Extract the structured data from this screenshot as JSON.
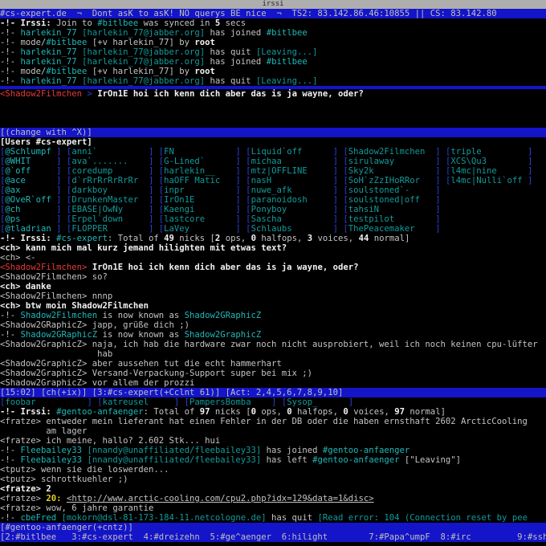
{
  "window": {
    "title": "irssi"
  },
  "c1": {
    "topic": "#cs-expert.de  ¬  Dont asK to asK! NO querys BE nice  ¬  TS2: 83.142.86.46:10855 || CS: 83.142.80",
    "l1a": "-!- Irssi: ",
    "l1b": "Join to ",
    "l1c": "#bitlbee",
    "l1d": " was synced in ",
    "l1e": "5",
    "l1f": " secs",
    "l2a": "-!- ",
    "l2b": "harlekin_77",
    "l2c": " [harlekin_77@jabber.org] ",
    "l2d": "has joined ",
    "l2e": "#bitlbee",
    "l3a": "-!- mode/",
    "l3b": "#bitlbee",
    "l3c": " [+v harlekin_77] by ",
    "l3d": "root",
    "l4a": "-!- ",
    "l4b": "harlekin_77",
    "l4c": " [harlekin_77@jabber.org] ",
    "l4d": "has quit ",
    "l4e": "[Leaving...]",
    "l5a": "-!- ",
    "l5b": "harlekin_77",
    "l5c": " [harlekin_77@jabber.org] ",
    "l5d": "has joined ",
    "l5e": "#bitlbee",
    "l6a": "-!- mode/",
    "l6b": "#bitlbee",
    "l6c": " [+v harlekin_77] by ",
    "l6d": "root",
    "l7a": "-!- ",
    "l7b": "harlekin_77",
    "l7c": " [harlekin_77@jabber.org] ",
    "l7d": "has quit ",
    "l7e": "[Leaving...]"
  },
  "c2": {
    "nick": "<Shadow2Filmchen",
    "sep": " > ",
    "msg": "IrOn1E hoi ich kenn dich aber das is ja wayne, oder?"
  },
  "c3": {
    "header": "[(change with ^X)]",
    "names": "[Users #cs-expert]",
    "rows": [
      [
        "@Schlumpf",
        "anni`",
        "FN",
        "Liquid`off",
        "Shadow2Filmchen",
        "triple"
      ],
      [
        "@WHIT",
        "ava`.......",
        "G-Lined`",
        "michaa",
        "sirulaway",
        "XCS\\Qu3"
      ],
      [
        "@`off",
        "coredump",
        "harlekin__",
        "mtz|OFFLINE",
        "Sky2k",
        "l4mc|nine"
      ],
      [
        "@ace",
        "d`rRrRrRrRrRr",
        "haOFF Matic",
        "nasH",
        "SoH`zZzIHoRRor",
        "l4mc|Nulli`off"
      ],
      [
        "@ax",
        "darkboy",
        "inpr",
        "nuwe_afk",
        "soulstoned`-",
        ""
      ],
      [
        "@OveR`off",
        "DrunkenMaster",
        "IrOn1E",
        "paranoidosh",
        "soulstoned|off",
        ""
      ],
      [
        "@ch",
        "EBASE|OwNy",
        "Kaengi",
        "Ponyboy",
        "tahsiN",
        ""
      ],
      [
        "@ps",
        "Erpel`down",
        "lastcore",
        "Sascha",
        "testpilot",
        ""
      ],
      [
        "@tladrian",
        "FLOPPER",
        "LaVey",
        "Schlaubs",
        "ThePeacemaker",
        ""
      ]
    ],
    "total": [
      "-!- Irssi: ",
      "#cs-expert",
      "Total of ",
      "49",
      " nicks [",
      "2",
      " ops, ",
      "0",
      " halfops, ",
      "3",
      " voices, ",
      "44",
      " normal]"
    ],
    "m1": "<ch> kann mich mal kurz jemand hilighten mit etwas text?",
    "m2": "<ch> <-",
    "m3a": "<Shadow2Filmchen> ",
    "m3b": "IrOn1E hoi ich kenn dich aber das is ja wayne, oder?",
    "m4": "<Shadow2Filmchen> so?",
    "m5": "<ch> danke",
    "m6": "<Shadow2Filmchen> nnnp",
    "m7": "<ch> btw moin Shadow2Filmchen",
    "m8a": "-!- ",
    "m8b": "Shadow2Filmchen",
    "m8c": " is now known as ",
    "m8d": "Shadow2GRaphicZ",
    "m9": "<Shadow2GRaphicZ> japp, grüße dich ;)",
    "m10a": "-!- ",
    "m10b": "Shadow2GRaphicZ",
    "m10c": " is now known as ",
    "m10d": "Shadow2GraphicZ",
    "m11": "<Shadow2GraphicZ> naja, ich hab die hardware zwar noch nicht ausprobiert, weil ich noch keinen cpu-lüfter",
    "m12": "                   hab",
    "m13": "<Shadow2GraphicZ> aber aussehen tut die echt hammerhart",
    "m14": "<Shadow2GraphicZ> Versand-Verpackung-Support super bei mix ;)",
    "m15": "<Shadow2GraphicZ> vor allem der prozzi",
    "status": "[15:02] [ch(+ix)] [3:#cs-expert(+Cclnt 61)] [Act: 2,4,5,6,7,8,9,10]"
  },
  "c4": {
    "tabs": [
      "foobar",
      "katreusel",
      "PampersBomba",
      "Sysop_"
    ],
    "total": [
      "-!- Irssi: ",
      "#gentoo-anfaenger",
      "Total of ",
      "97",
      " nicks [",
      "0",
      " ops, ",
      "0",
      " halfops, ",
      "0",
      " voices, ",
      "97",
      " normal]"
    ],
    "m1": "<fratze> entweder mein lieferant hat einen Fehler in der DB oder die haben ernsthaft 2602 ArcticCooling",
    "m2": "         am lager",
    "m3": "<fratze> ich meine, hallo? 2.602 Stk... hui",
    "m4a": "-!- ",
    "m4b": "Fleebailey33",
    "m4c": " [nnandy@unaffiliated/fleebailey33] ",
    "m4d": "has joined ",
    "m4e": "#gentoo-anfaenger",
    "m5a": "-!- ",
    "m5b": "Fleebailey33",
    "m5c": " [nnandy@unaffiliated/fleebailey33] ",
    "m5d": "has left ",
    "m5e": "#gentoo-anfaenger",
    "m5f": " [\"Leaving\"]",
    "m6": "<tputz> wenn sie die loswerden...",
    "m7": "<tputz> schrottkuehler ;)",
    "m8": "<fratze> 2",
    "m9a": "<fratze> ",
    "m9b": "20:",
    "m9c": " ",
    "m9d": "<http://www.arctic-cooling.com/cpu2.php?idx=129&data=1&disc>",
    "m10": "<fratze> wow, 6 jahre garantie",
    "m11a": "-!- ",
    "m11b": "cbeFred",
    "m11c": " [mokorn@dsl-81-173-184-11.netcologne.de] ",
    "m11d": "has quit ",
    "m11e": "[Read error: 104 (Connection reset by pee",
    "prompt": "[#gentoo-anfaenger(+cntz)]",
    "bottom": "[2:#bitlbee   3:#cs-expert  4:#dreizehn  5:#ge^aenger  6:hilight        7:#Papa^umpF  8:#irc         9:#sshs"
  }
}
